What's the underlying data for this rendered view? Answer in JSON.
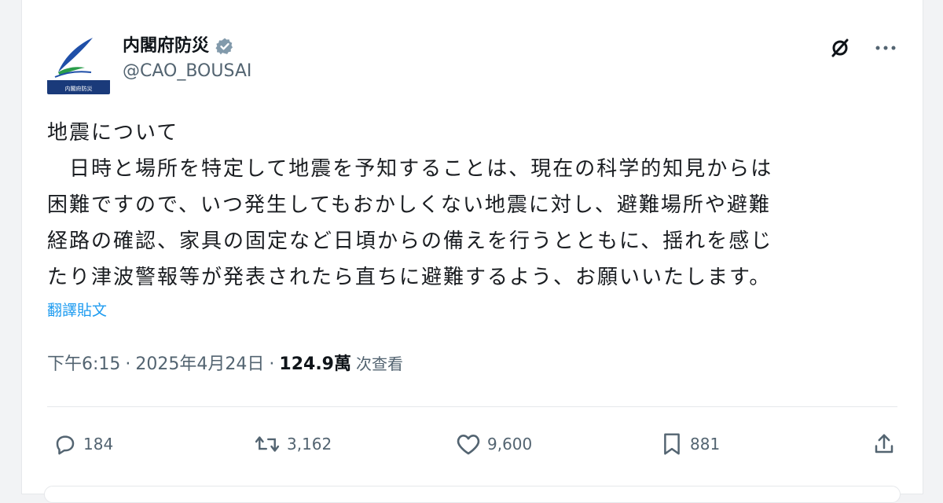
{
  "post": {
    "author": {
      "display_name": "内閣府防災",
      "handle": "@CAO_BOUSAI",
      "avatar_caption": "内閣府防災",
      "verified": true
    },
    "text": {
      "title": "地震について",
      "lines": [
        "日時と場所を特定して地震を予知することは、現在の科学的知見からは",
        "困難ですので、いつ発生してもおかしくない地震に対し、避難場所や避難",
        "経路の確認、家具の固定など日頃からの備えを行うとともに、揺れを感じ",
        "たり津波警報等が発表されたら直ちに避難するよう、お願いいたします。"
      ]
    },
    "translate_label": "翻譯貼文",
    "meta": {
      "time": "下午6:15",
      "date": "2025年4月24日",
      "views": "124.9萬",
      "views_label": "次查看"
    },
    "counts": {
      "replies": "184",
      "reposts": "3,162",
      "likes": "9,600",
      "bookmarks": "881"
    }
  },
  "icons": {
    "verified": "verified-badge-icon",
    "grok": "grok-icon",
    "more": "more-icon",
    "reply": "reply-icon",
    "repost": "repost-icon",
    "like": "heart-icon",
    "bookmark": "bookmark-icon",
    "share": "share-icon"
  },
  "colors": {
    "link": "#1d9bf0",
    "secondary_text": "#536471",
    "avatar_navy": "#1a3a7a"
  }
}
